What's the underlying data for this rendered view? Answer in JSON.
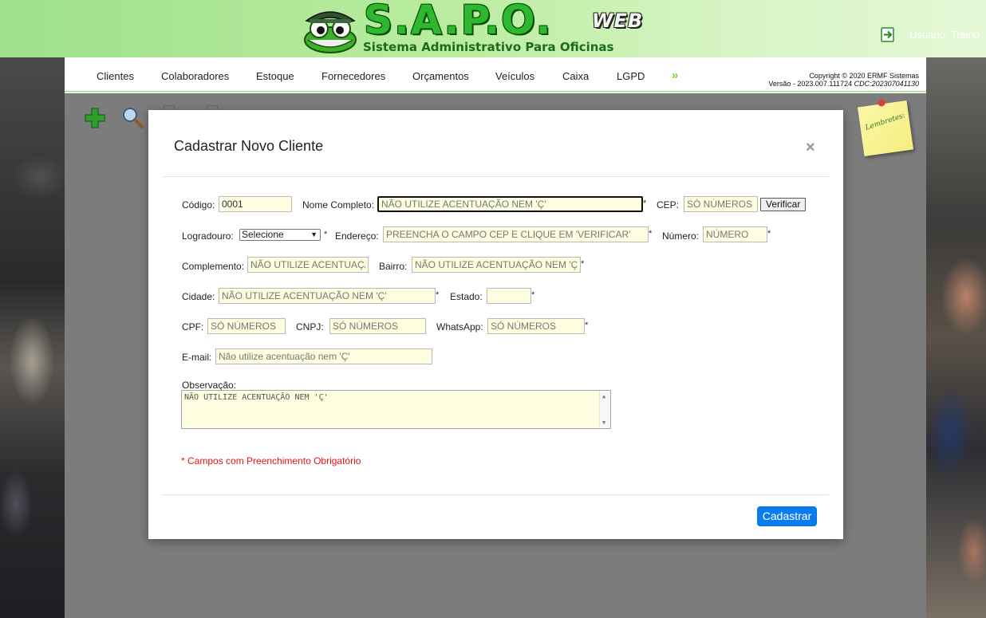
{
  "header": {
    "logo_title": "S.A.P.O.",
    "logo_web": "WEB",
    "logo_subtitle": "Sistema Administrativo Para Oficinas",
    "user_label": "Usuário: Treino"
  },
  "nav": {
    "items": [
      "Clientes",
      "Colaboradores",
      "Estoque",
      "Fornecedores",
      "Orçamentos",
      "Veículos",
      "Caixa",
      "LGPD"
    ],
    "more": "»",
    "copyright_line1": "Copyright © 2020 ERMF Sistemas",
    "copyright_line2": "Versão - 2023.007.111724 ",
    "copyright_cdc": "CDC:202307041130"
  },
  "sticky": {
    "label": "Lembretes:"
  },
  "modal": {
    "title": "Cadastrar Novo Cliente",
    "close": "×",
    "labels": {
      "codigo": "Código:",
      "nome": "Nome Completo:",
      "cep": "CEP:",
      "logradouro": "Logradouro:",
      "endereco": "Endereço:",
      "numero": "Número:",
      "complemento": "Complemento:",
      "bairro": "Bairro:",
      "cidade": "Cidade:",
      "estado": "Estado:",
      "cpf": "CPF:",
      "cnpj": "CNPJ:",
      "whatsapp": "WhatsApp:",
      "email": "E-mail:",
      "observacao": "Observação:"
    },
    "values": {
      "codigo": "0001"
    },
    "placeholders": {
      "nome": "NÃO UTILIZE ACENTUAÇÃO NEM 'Ç'",
      "cep": "SÓ NÚMEROS",
      "endereco": "PREENCHA O CAMPO CEP E CLIQUE EM 'VERIFICAR'",
      "numero": "NÚMERO",
      "complemento": "NÃO UTILIZE ACENTUAÇÃO NEM 'Ç'",
      "bairro": "NÃO UTILIZE ACENTUAÇÃO NEM 'Ç'",
      "cidade": "NÃO UTILIZE ACENTUAÇÃO NEM 'Ç'",
      "estado": "",
      "cpf": "SÓ NÚMEROS",
      "cnpj": "SÓ NÚMEROS",
      "whatsapp": "SÓ NÚMEROS",
      "email": "Não utilize acentuação nem 'Ç'"
    },
    "observacao_placeholder": "NÃO UTILIZE ACENTUAÇÃO NEM 'Ç'",
    "logradouro_selected": "Selecione",
    "verify_button": "Verificar",
    "required_mark": "*",
    "required_note": "* Campos com Preenchimento Obrigatório",
    "submit_button": "Cadastrar"
  },
  "colors": {
    "header_green": "#9fe08c",
    "accent_blue": "#0a7cf0",
    "input_bg": "#fffde0",
    "required_red": "#e01414"
  }
}
